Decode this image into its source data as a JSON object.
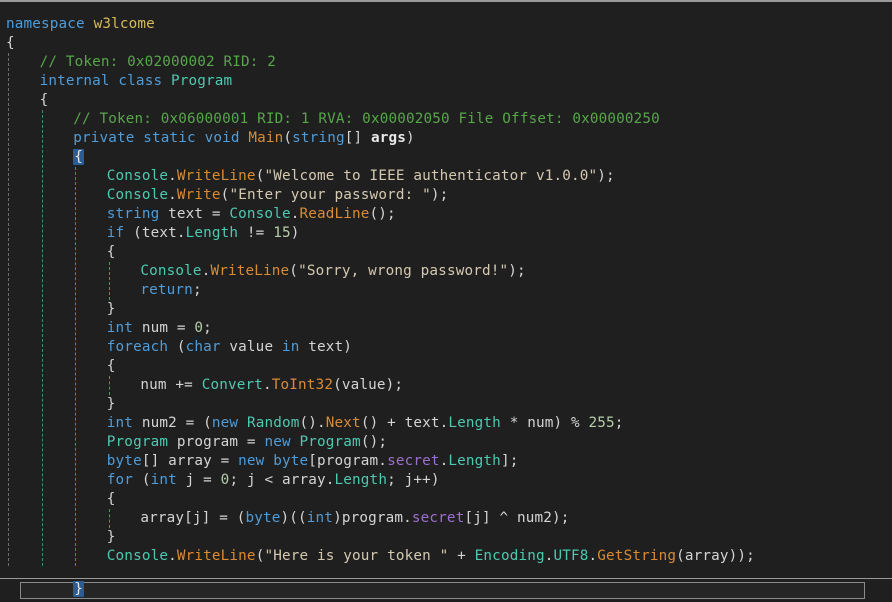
{
  "editor": {
    "language": "csharp",
    "background_color": "#1f1f1f",
    "default_text_color": "#d4d4d4",
    "font_size_px": 14,
    "theme": "dark"
  },
  "colors": {
    "keyword": "#4f9cd9",
    "type": "#4ec9b0",
    "namespace_name": "#d7ba5a",
    "method": "#d98b34",
    "string": "#d4c9b0",
    "comment": "#57a64a",
    "number": "#b5cea8",
    "field": "#9b6fd0",
    "parameter": "#e8e8e8",
    "brace_match_highlight": "#2a5c96",
    "indent_guide_level0": "#6e6e6e",
    "indent_guide_level1": "#3f8f6f",
    "indent_guide_level2": "#4a7fb5",
    "indent_guide_level3": "#4f9a58",
    "indent_guide_level4": "#8a5fa8",
    "scrollbar_border": "#8a8a8a",
    "panel_divider": "#9a9a9a"
  },
  "code": {
    "lines": [
      {
        "n": 1,
        "indent": 0,
        "tokens": [
          {
            "t": "namespace",
            "c": "kw"
          },
          {
            "t": " ",
            "c": "pun"
          },
          {
            "t": "w3lcome",
            "c": "ns"
          }
        ]
      },
      {
        "n": 2,
        "indent": 0,
        "tokens": [
          {
            "t": "{",
            "c": "pun"
          }
        ]
      },
      {
        "n": 3,
        "indent": 1,
        "tokens": [
          {
            "t": "// Token: 0x02000002 RID: 2",
            "c": "cmt"
          }
        ]
      },
      {
        "n": 4,
        "indent": 1,
        "tokens": [
          {
            "t": "internal",
            "c": "kw"
          },
          {
            "t": " ",
            "c": "pun"
          },
          {
            "t": "class",
            "c": "kw"
          },
          {
            "t": " ",
            "c": "pun"
          },
          {
            "t": "Program",
            "c": "typ"
          }
        ]
      },
      {
        "n": 5,
        "indent": 1,
        "tokens": [
          {
            "t": "{",
            "c": "pun"
          }
        ]
      },
      {
        "n": 6,
        "indent": 2,
        "tokens": [
          {
            "t": "// Token: 0x06000001 RID: 1 RVA: 0x00002050 File Offset: 0x00000250",
            "c": "cmt"
          }
        ]
      },
      {
        "n": 7,
        "indent": 2,
        "tokens": [
          {
            "t": "private",
            "c": "kw"
          },
          {
            "t": " ",
            "c": "pun"
          },
          {
            "t": "static",
            "c": "kw"
          },
          {
            "t": " ",
            "c": "pun"
          },
          {
            "t": "void",
            "c": "kw"
          },
          {
            "t": " ",
            "c": "pun"
          },
          {
            "t": "Main",
            "c": "mth"
          },
          {
            "t": "(",
            "c": "pun"
          },
          {
            "t": "string",
            "c": "kw"
          },
          {
            "t": "[] ",
            "c": "pun"
          },
          {
            "t": "args",
            "c": "par"
          },
          {
            "t": ")",
            "c": "pun"
          }
        ]
      },
      {
        "n": 8,
        "indent": 2,
        "tokens": [
          {
            "t": "{",
            "c": "brace-hl"
          }
        ]
      },
      {
        "n": 9,
        "indent": 3,
        "tokens": [
          {
            "t": "Console",
            "c": "typ"
          },
          {
            "t": ".",
            "c": "pun"
          },
          {
            "t": "WriteLine",
            "c": "mth"
          },
          {
            "t": "(",
            "c": "pun"
          },
          {
            "t": "\"Welcome to IEEE authenticator v1.0.0\"",
            "c": "str"
          },
          {
            "t": ");",
            "c": "pun"
          }
        ]
      },
      {
        "n": 10,
        "indent": 3,
        "tokens": [
          {
            "t": "Console",
            "c": "typ"
          },
          {
            "t": ".",
            "c": "pun"
          },
          {
            "t": "Write",
            "c": "mth"
          },
          {
            "t": "(",
            "c": "pun"
          },
          {
            "t": "\"Enter your password: \"",
            "c": "str"
          },
          {
            "t": ");",
            "c": "pun"
          }
        ]
      },
      {
        "n": 11,
        "indent": 3,
        "tokens": [
          {
            "t": "string",
            "c": "kw"
          },
          {
            "t": " text = ",
            "c": "pun"
          },
          {
            "t": "Console",
            "c": "typ"
          },
          {
            "t": ".",
            "c": "pun"
          },
          {
            "t": "ReadLine",
            "c": "mth"
          },
          {
            "t": "();",
            "c": "pun"
          }
        ]
      },
      {
        "n": 12,
        "indent": 3,
        "tokens": [
          {
            "t": "if",
            "c": "kw"
          },
          {
            "t": " (text.",
            "c": "pun"
          },
          {
            "t": "Length",
            "c": "prp"
          },
          {
            "t": " != ",
            "c": "pun"
          },
          {
            "t": "15",
            "c": "num"
          },
          {
            "t": ")",
            "c": "pun"
          }
        ]
      },
      {
        "n": 13,
        "indent": 3,
        "tokens": [
          {
            "t": "{",
            "c": "pun"
          }
        ]
      },
      {
        "n": 14,
        "indent": 4,
        "tokens": [
          {
            "t": "Console",
            "c": "typ"
          },
          {
            "t": ".",
            "c": "pun"
          },
          {
            "t": "WriteLine",
            "c": "mth"
          },
          {
            "t": "(",
            "c": "pun"
          },
          {
            "t": "\"Sorry, wrong password!\"",
            "c": "str"
          },
          {
            "t": ");",
            "c": "pun"
          }
        ]
      },
      {
        "n": 15,
        "indent": 4,
        "tokens": [
          {
            "t": "return",
            "c": "kw"
          },
          {
            "t": ";",
            "c": "pun"
          }
        ]
      },
      {
        "n": 16,
        "indent": 3,
        "tokens": [
          {
            "t": "}",
            "c": "pun"
          }
        ]
      },
      {
        "n": 17,
        "indent": 3,
        "tokens": [
          {
            "t": "int",
            "c": "kw"
          },
          {
            "t": " num = ",
            "c": "pun"
          },
          {
            "t": "0",
            "c": "num"
          },
          {
            "t": ";",
            "c": "pun"
          }
        ]
      },
      {
        "n": 18,
        "indent": 3,
        "tokens": [
          {
            "t": "foreach",
            "c": "kw"
          },
          {
            "t": " (",
            "c": "pun"
          },
          {
            "t": "char",
            "c": "kw"
          },
          {
            "t": " value ",
            "c": "pun"
          },
          {
            "t": "in",
            "c": "kw"
          },
          {
            "t": " text)",
            "c": "pun"
          }
        ]
      },
      {
        "n": 19,
        "indent": 3,
        "tokens": [
          {
            "t": "{",
            "c": "pun"
          }
        ]
      },
      {
        "n": 20,
        "indent": 4,
        "tokens": [
          {
            "t": "num += ",
            "c": "pun"
          },
          {
            "t": "Convert",
            "c": "typ"
          },
          {
            "t": ".",
            "c": "pun"
          },
          {
            "t": "ToInt32",
            "c": "mth"
          },
          {
            "t": "(value);",
            "c": "pun"
          }
        ]
      },
      {
        "n": 21,
        "indent": 3,
        "tokens": [
          {
            "t": "}",
            "c": "pun"
          }
        ]
      },
      {
        "n": 22,
        "indent": 3,
        "tokens": [
          {
            "t": "int",
            "c": "kw"
          },
          {
            "t": " num2 = (",
            "c": "pun"
          },
          {
            "t": "new",
            "c": "kw"
          },
          {
            "t": " ",
            "c": "pun"
          },
          {
            "t": "Random",
            "c": "typ"
          },
          {
            "t": "().",
            "c": "pun"
          },
          {
            "t": "Next",
            "c": "mth"
          },
          {
            "t": "() + text.",
            "c": "pun"
          },
          {
            "t": "Length",
            "c": "prp"
          },
          {
            "t": " * num) % ",
            "c": "pun"
          },
          {
            "t": "255",
            "c": "num"
          },
          {
            "t": ";",
            "c": "pun"
          }
        ]
      },
      {
        "n": 23,
        "indent": 3,
        "tokens": [
          {
            "t": "Program",
            "c": "typ"
          },
          {
            "t": " program = ",
            "c": "pun"
          },
          {
            "t": "new",
            "c": "kw"
          },
          {
            "t": " ",
            "c": "pun"
          },
          {
            "t": "Program",
            "c": "typ"
          },
          {
            "t": "();",
            "c": "pun"
          }
        ]
      },
      {
        "n": 24,
        "indent": 3,
        "tokens": [
          {
            "t": "byte",
            "c": "kw"
          },
          {
            "t": "[] array = ",
            "c": "pun"
          },
          {
            "t": "new",
            "c": "kw"
          },
          {
            "t": " ",
            "c": "pun"
          },
          {
            "t": "byte",
            "c": "kw"
          },
          {
            "t": "[program.",
            "c": "pun"
          },
          {
            "t": "secret",
            "c": "fld"
          },
          {
            "t": ".",
            "c": "pun"
          },
          {
            "t": "Length",
            "c": "prp"
          },
          {
            "t": "];",
            "c": "pun"
          }
        ]
      },
      {
        "n": 25,
        "indent": 3,
        "tokens": [
          {
            "t": "for",
            "c": "kw"
          },
          {
            "t": " (",
            "c": "pun"
          },
          {
            "t": "int",
            "c": "kw"
          },
          {
            "t": " j = ",
            "c": "pun"
          },
          {
            "t": "0",
            "c": "num"
          },
          {
            "t": "; j < array.",
            "c": "pun"
          },
          {
            "t": "Length",
            "c": "prp"
          },
          {
            "t": "; j++)",
            "c": "pun"
          }
        ]
      },
      {
        "n": 26,
        "indent": 3,
        "tokens": [
          {
            "t": "{",
            "c": "pun"
          }
        ]
      },
      {
        "n": 27,
        "indent": 4,
        "tokens": [
          {
            "t": "array[j] = (",
            "c": "pun"
          },
          {
            "t": "byte",
            "c": "kw"
          },
          {
            "t": ")((",
            "c": "pun"
          },
          {
            "t": "int",
            "c": "kw"
          },
          {
            "t": ")program.",
            "c": "pun"
          },
          {
            "t": "secret",
            "c": "fld"
          },
          {
            "t": "[j] ^ num2);",
            "c": "pun"
          }
        ]
      },
      {
        "n": 28,
        "indent": 3,
        "tokens": [
          {
            "t": "}",
            "c": "pun"
          }
        ]
      },
      {
        "n": 29,
        "indent": 3,
        "tokens": [
          {
            "t": "Console",
            "c": "typ"
          },
          {
            "t": ".",
            "c": "pun"
          },
          {
            "t": "WriteLine",
            "c": "mth"
          },
          {
            "t": "(",
            "c": "pun"
          },
          {
            "t": "\"Here is your token \"",
            "c": "str"
          },
          {
            "t": " + ",
            "c": "pun"
          },
          {
            "t": "Encoding",
            "c": "typ"
          },
          {
            "t": ".",
            "c": "pun"
          },
          {
            "t": "UTF8",
            "c": "prp"
          },
          {
            "t": ".",
            "c": "pun"
          },
          {
            "t": "GetString",
            "c": "mth"
          },
          {
            "t": "(array));",
            "c": "pun"
          }
        ]
      }
    ],
    "last_line": {
      "n": 30,
      "indent": 2,
      "text": "}",
      "highlighted": true
    }
  },
  "scrollbar": {
    "orientation": "horizontal",
    "position": "bottom"
  }
}
